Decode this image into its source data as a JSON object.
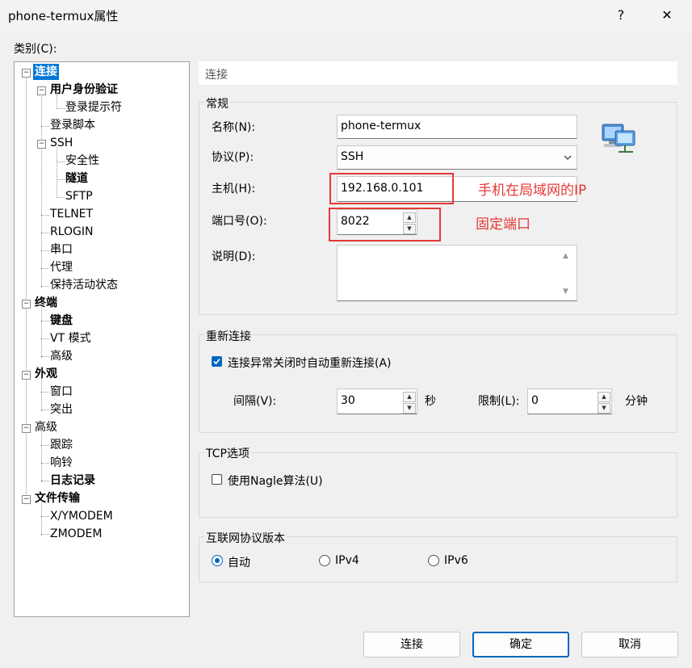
{
  "window": {
    "title": "phone-termux属性",
    "help": "?",
    "close": "✕"
  },
  "category_label": "类别(C):",
  "tree": [
    {
      "label": "连接",
      "bold": true,
      "selected": true
    },
    {
      "label": "用户身份验证",
      "bold": true
    },
    {
      "label": "登录提示符"
    },
    {
      "label": "登录脚本"
    },
    {
      "label": "SSH"
    },
    {
      "label": "安全性"
    },
    {
      "label": "隧道",
      "bold": true
    },
    {
      "label": "SFTP"
    },
    {
      "label": "TELNET"
    },
    {
      "label": "RLOGIN"
    },
    {
      "label": "串口"
    },
    {
      "label": "代理"
    },
    {
      "label": "保持活动状态"
    },
    {
      "label": "终端",
      "bold": true
    },
    {
      "label": "键盘",
      "bold": true
    },
    {
      "label": "VT 模式"
    },
    {
      "label": "高级"
    },
    {
      "label": "外观",
      "bold": true
    },
    {
      "label": "窗口"
    },
    {
      "label": "突出"
    },
    {
      "label": "高级"
    },
    {
      "label": "跟踪"
    },
    {
      "label": "响铃"
    },
    {
      "label": "日志记录",
      "bold": true
    },
    {
      "label": "文件传输",
      "bold": true
    },
    {
      "label": "X/YMODEM"
    },
    {
      "label": "ZMODEM"
    }
  ],
  "panel_header": "连接",
  "general": {
    "title": "常规",
    "name_label": "名称(N):",
    "name_value": "phone-termux",
    "protocol_label": "协议(P):",
    "protocol_value": "SSH",
    "host_label": "主机(H):",
    "host_value": "192.168.0.101",
    "port_label": "端口号(O):",
    "port_value": "8022",
    "desc_label": "说明(D):",
    "desc_value": ""
  },
  "annotations": {
    "host_note": "手机在局域网的IP",
    "port_note": "固定端口",
    "color": "#e53935"
  },
  "reconnect": {
    "title": "重新连接",
    "checkbox_label": "连接异常关闭时自动重新连接(A)",
    "checked": true,
    "interval_label": "间隔(V):",
    "interval_value": "30",
    "interval_unit": "秒",
    "limit_label": "限制(L):",
    "limit_value": "0",
    "limit_unit": "分钟"
  },
  "tcp": {
    "title": "TCP选项",
    "nagle_label": "使用Nagle算法(U)",
    "nagle_checked": false
  },
  "ipver": {
    "title": "互联网协议版本",
    "options": [
      "自动",
      "IPv4",
      "IPv6"
    ],
    "selected": "自动"
  },
  "buttons": {
    "connect": "连接",
    "ok": "确定",
    "cancel": "取消"
  },
  "colors": {
    "accent": "#0067c0",
    "selection": "#0078d7"
  }
}
